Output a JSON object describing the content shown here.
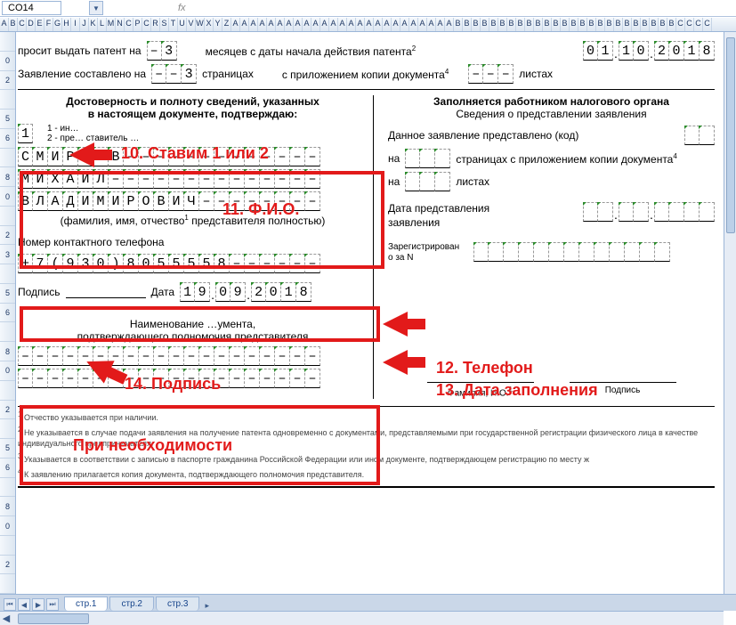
{
  "cell_ref": "CO14",
  "fx": "fx",
  "col_letters": [
    "A",
    "B",
    "C",
    "D",
    "E",
    "F",
    "G",
    "H",
    "I",
    "J",
    "K",
    "L",
    "M",
    "N",
    "C",
    "P",
    "C",
    "R",
    "S",
    "T",
    "U",
    "V",
    "W",
    "X",
    "Y",
    "Z",
    "A",
    "A",
    "A",
    "A",
    "A",
    "A",
    "A",
    "A",
    "A",
    "A",
    "A",
    "A",
    "A",
    "A",
    "A",
    "A",
    "A",
    "A",
    "A",
    "A",
    "A",
    "A",
    "A",
    "A",
    "A",
    "B",
    "B",
    "B",
    "B",
    "B",
    "B",
    "B",
    "B",
    "B",
    "B",
    "B",
    "B",
    "B",
    "B",
    "B",
    "B",
    "B",
    "B",
    "B",
    "B",
    "B",
    "B",
    "B",
    "B",
    "B",
    "C",
    "C",
    "C",
    "C"
  ],
  "rows": [
    "",
    "0",
    "2",
    "",
    "5",
    "6",
    "",
    "8",
    "0",
    "",
    "2",
    "3",
    "",
    "5",
    "6",
    "",
    "8",
    "0",
    "",
    "2",
    "",
    "5",
    "6",
    "",
    "8",
    "0",
    "",
    "2",
    ""
  ],
  "top1_label": "просит выдать патент на",
  "top1_cells": [
    "–",
    "3"
  ],
  "top1_mid": "месяцев с даты начала действия патента",
  "top1_sup": "2",
  "date1": [
    "0",
    "1",
    "1",
    "0",
    "2",
    "0",
    "1",
    "8"
  ],
  "top2_label": "Заявление составлено на",
  "top2_cells": [
    "–",
    "–",
    "3"
  ],
  "top2_mid": "страницах",
  "top2_right": "с приложением копии документа",
  "top2_sup": "4",
  "top2_blank": [
    "–",
    "–",
    "–"
  ],
  "top2_sheets": "листах",
  "left_hdr1": "Достоверность и полноту сведений, указанных",
  "left_hdr2": "в настоящем документе, подтверждаю:",
  "opt1": "1 - ин…",
  "opt2": "2 - пре… ставитель …",
  "choice": [
    "1"
  ],
  "name_rows": [
    [
      "С",
      "М",
      "И",
      "Р",
      "Н",
      "О",
      "В",
      "–",
      "–",
      "–",
      "–",
      "–",
      "–",
      "–",
      "–",
      "–",
      "–",
      "–",
      "–",
      "–"
    ],
    [
      "М",
      "И",
      "Х",
      "А",
      "И",
      "Л",
      "–",
      "–",
      "–",
      "–",
      "–",
      "–",
      "–",
      "–",
      "–",
      "–",
      "–",
      "–",
      "–",
      "–"
    ],
    [
      "В",
      "Л",
      "А",
      "Д",
      "И",
      "М",
      "И",
      "Р",
      "О",
      "В",
      "И",
      "Ч",
      "–",
      "–",
      "–",
      "–",
      "–",
      "–",
      "–",
      "–"
    ]
  ],
  "fio_caption": "(фамилия, имя, отчество",
  "fio_sup": "1",
  "fio_caption2": " представителя полностью)",
  "phone_label": "Номер контактного телефона",
  "phone": [
    "+",
    "7",
    "(",
    "9",
    "3",
    "0",
    ")",
    "8",
    "0",
    "5",
    "5",
    "5",
    "5",
    "8",
    "–",
    "–",
    "–",
    "–",
    "–",
    "–"
  ],
  "sign_label": "Подпись",
  "date_label": "Дата",
  "sign_date": [
    "1",
    "9",
    "0",
    "9",
    "2",
    "0",
    "1",
    "8"
  ],
  "doc_hdr1": "Наименование …умента,",
  "doc_hdr2": "подтверждающего полномочия представителя",
  "blank_rows": [
    [
      "–",
      "–",
      "–",
      "–",
      "–",
      "–",
      "–",
      "–",
      "–",
      "–",
      "–",
      "–",
      "–",
      "–",
      "–",
      "–",
      "–",
      "–",
      "–",
      "–"
    ],
    [
      "–",
      "–",
      "–",
      "–",
      "–",
      "–",
      "–",
      "–",
      "–",
      "–",
      "–",
      "–",
      "–",
      "–",
      "–",
      "–",
      "–",
      "–",
      "–",
      "–"
    ]
  ],
  "right_hdr": "Заполняется работником налогового органа",
  "right_sub": "Сведения о представлении заявления",
  "r1": "Данное заявление представлено (код)",
  "r2a": "на",
  "r2b": "страницах с приложением копии документа",
  "r2sup": "4",
  "r3a": "на",
  "r3b": "листах",
  "r4": "Дата представления",
  "r4b": "заявления",
  "r5a": "Зарегистрирован",
  "r5b": "о за N",
  "r_sign1": "Фамилия, И.О.",
  "r_sign1_sup": "1",
  "r_sign2": "Подпись",
  "fn1_sup": "1",
  "fn1": " Отчество указывается при наличии.",
  "fn2_sup": "2",
  "fn2": " Не указывается в случае подачи заявления на получение патента одновременно с документами, представляемыми при государственной регистрации физического лица в качестве индивидуального предпринимателя.",
  "fn3_sup": "3",
  "fn3": " Указывается в соответствии с записью в паспорте гражданина Российской Федерации или ином документе, подтверждающем регистрацию по месту ж",
  "fn4_sup": "4",
  "fn4": " К заявлению прилагается копия документа, подтверждающего полномочия представителя.",
  "callouts": {
    "c10": "10. Ставим 1 или 2",
    "c11": "11. Ф.И.О.",
    "c12": "12. Телефон",
    "c13": "13. Дата заполнения",
    "c14": "14. Подпись",
    "c15": "При необходимости"
  },
  "tabs": [
    "стр.1",
    "стр.2",
    "стр.3"
  ]
}
